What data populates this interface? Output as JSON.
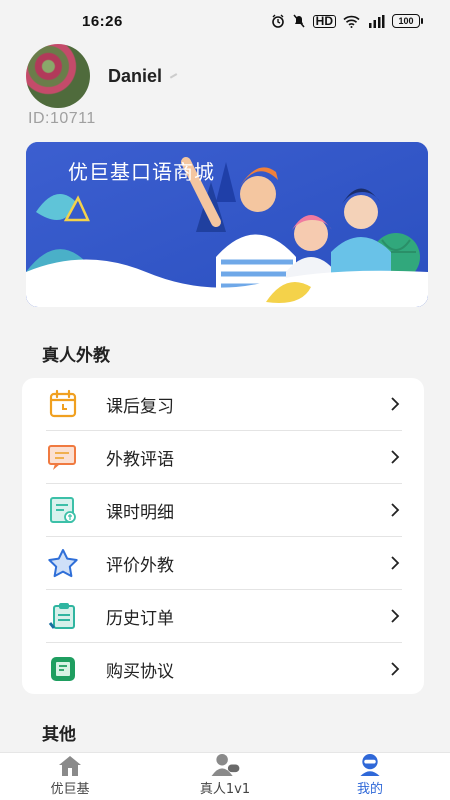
{
  "status_bar": {
    "time": "16:26",
    "icons": [
      "alarm-icon",
      "mute-icon",
      "hd-icon",
      "wifi-icon",
      "signal-icon"
    ],
    "hd_label": "HD",
    "battery": "100"
  },
  "profile": {
    "username": "Daniel",
    "user_id": "ID:10711"
  },
  "banner": {
    "title": "优巨基口语商城"
  },
  "sections": {
    "real_teacher_title": "真人外教",
    "other_title": "其他"
  },
  "menu": {
    "items": [
      {
        "label": "课后复习",
        "icon": "calendar-icon",
        "color": "#f0a020"
      },
      {
        "label": "外教评语",
        "icon": "comment-icon",
        "color": "#f07a40"
      },
      {
        "label": "课时明细",
        "icon": "receipt-icon",
        "color": "#3cc0a8"
      },
      {
        "label": "评价外教",
        "icon": "star-icon",
        "color": "#2f6fd8"
      },
      {
        "label": "历史订单",
        "icon": "order-icon",
        "color": "#2fb5a0"
      },
      {
        "label": "购买协议",
        "icon": "agreement-icon",
        "color": "#1f9e60"
      }
    ]
  },
  "tabs": [
    {
      "label": "优巨基",
      "icon": "home-icon",
      "active": false
    },
    {
      "label": "真人1v1",
      "icon": "teacher-icon",
      "active": false
    },
    {
      "label": "我的",
      "icon": "profile-icon",
      "active": true
    }
  ],
  "colors": {
    "accent": "#2f68d8",
    "background": "#f3f3f3",
    "banner": "#2e55c8"
  }
}
